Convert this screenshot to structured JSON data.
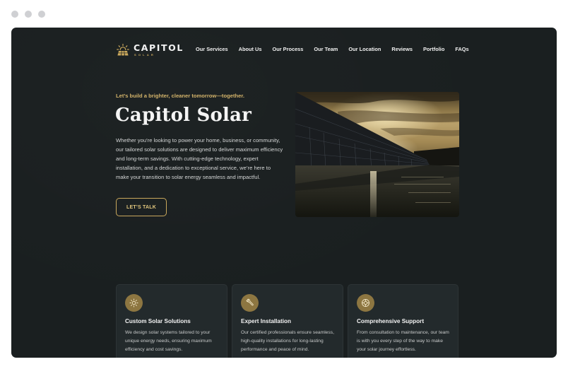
{
  "window": {
    "controls": [
      "close",
      "minimize",
      "maximize"
    ]
  },
  "header": {
    "logo": {
      "title": "CAPITOL",
      "subtitle": "SOLAR",
      "icon": "solar-panel-sun-icon"
    },
    "nav": [
      {
        "label": "Our Services"
      },
      {
        "label": "About Us"
      },
      {
        "label": "Our Process"
      },
      {
        "label": "Our Team"
      },
      {
        "label": "Our Location"
      },
      {
        "label": "Reviews"
      },
      {
        "label": "Portfolio"
      },
      {
        "label": "FAQs"
      }
    ]
  },
  "hero": {
    "tagline": "Let’s build a brighter, cleaner tomorrow—together.",
    "title": "Capitol Solar",
    "description": "Whether you’re looking to power your home, business, or community, our tailored solar solutions are designed to deliver maximum efficiency and long-term savings. With cutting-edge technology, expert installation, and a dedication to exceptional service, we’re here to make your transition to solar energy seamless and impactful.",
    "cta_label": "LET’S TALK",
    "image_alt": "Solar panels along water at sunset"
  },
  "features": [
    {
      "icon": "sun-icon",
      "title": "Custom Solar Solutions",
      "description": "We design solar systems tailored to your unique energy needs, ensuring maximum efficiency and cost savings."
    },
    {
      "icon": "wrench-icon",
      "title": "Expert Installation",
      "description": "Our certified professionals ensure seamless, high-quality installations for long-lasting performance and peace of mind."
    },
    {
      "icon": "lifebuoy-icon",
      "title": "Comprehensive Support",
      "description": "From consultation to maintenance, our team is with you every step of the way to make your solar journey effortless."
    }
  ],
  "colors": {
    "background": "#1a1f20",
    "accent": "#c9a85c",
    "card": "#232a2c",
    "icon_circle": "#8d7641"
  }
}
